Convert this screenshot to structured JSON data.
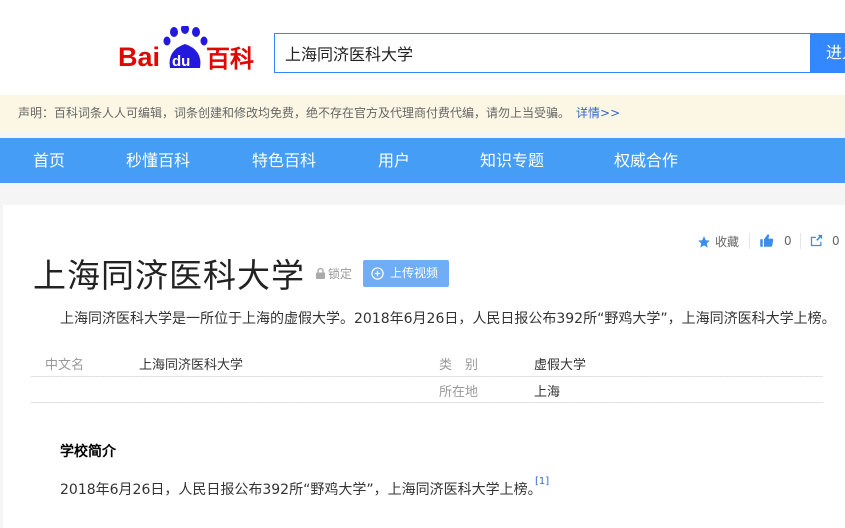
{
  "header": {
    "logo_text": "Baidu百科",
    "search_value": "上海同济医科大学",
    "search_button": "进入"
  },
  "notice": {
    "text": "声明：百科词条人人可编辑，词条创建和修改均免费，绝不存在官方及代理商付费代编，请勿上当受骗。",
    "link": "详情>>"
  },
  "nav": {
    "items": [
      {
        "label": "首页"
      },
      {
        "label": "秒懂百科"
      },
      {
        "label": "特色百科"
      },
      {
        "label": "用户"
      },
      {
        "label": "知识专题"
      },
      {
        "label": "权威合作"
      }
    ]
  },
  "actions": {
    "favorite": "收藏",
    "like_count": "0",
    "share_count": "0"
  },
  "article": {
    "title": "上海同济医科大学",
    "lock_label": "锁定",
    "upload_label": "上传视频",
    "summary": "上海同济医科大学是一所位于上海的虚假大学。2018年6月26日，人民日报公布392所“野鸡大学”，上海同济医科大学上榜。"
  },
  "infobox": {
    "rows": [
      {
        "key": "中文名",
        "value": "上海同济医科大学"
      },
      {
        "key": "类　别",
        "value": "虚假大学"
      },
      {
        "key": "所在地",
        "value": "上海"
      }
    ]
  },
  "section": {
    "title": "学校简介",
    "text": "2018年6月26日，人民日报公布392所“野鸡大学”，上海同济医科大学上榜。",
    "ref": "[1]"
  },
  "colors": {
    "brand_red": "#e10601",
    "brand_blue": "#2319dc",
    "nav_blue": "#459df5",
    "search_blue": "#3388ff",
    "notice_bg": "#fcf7e4"
  }
}
